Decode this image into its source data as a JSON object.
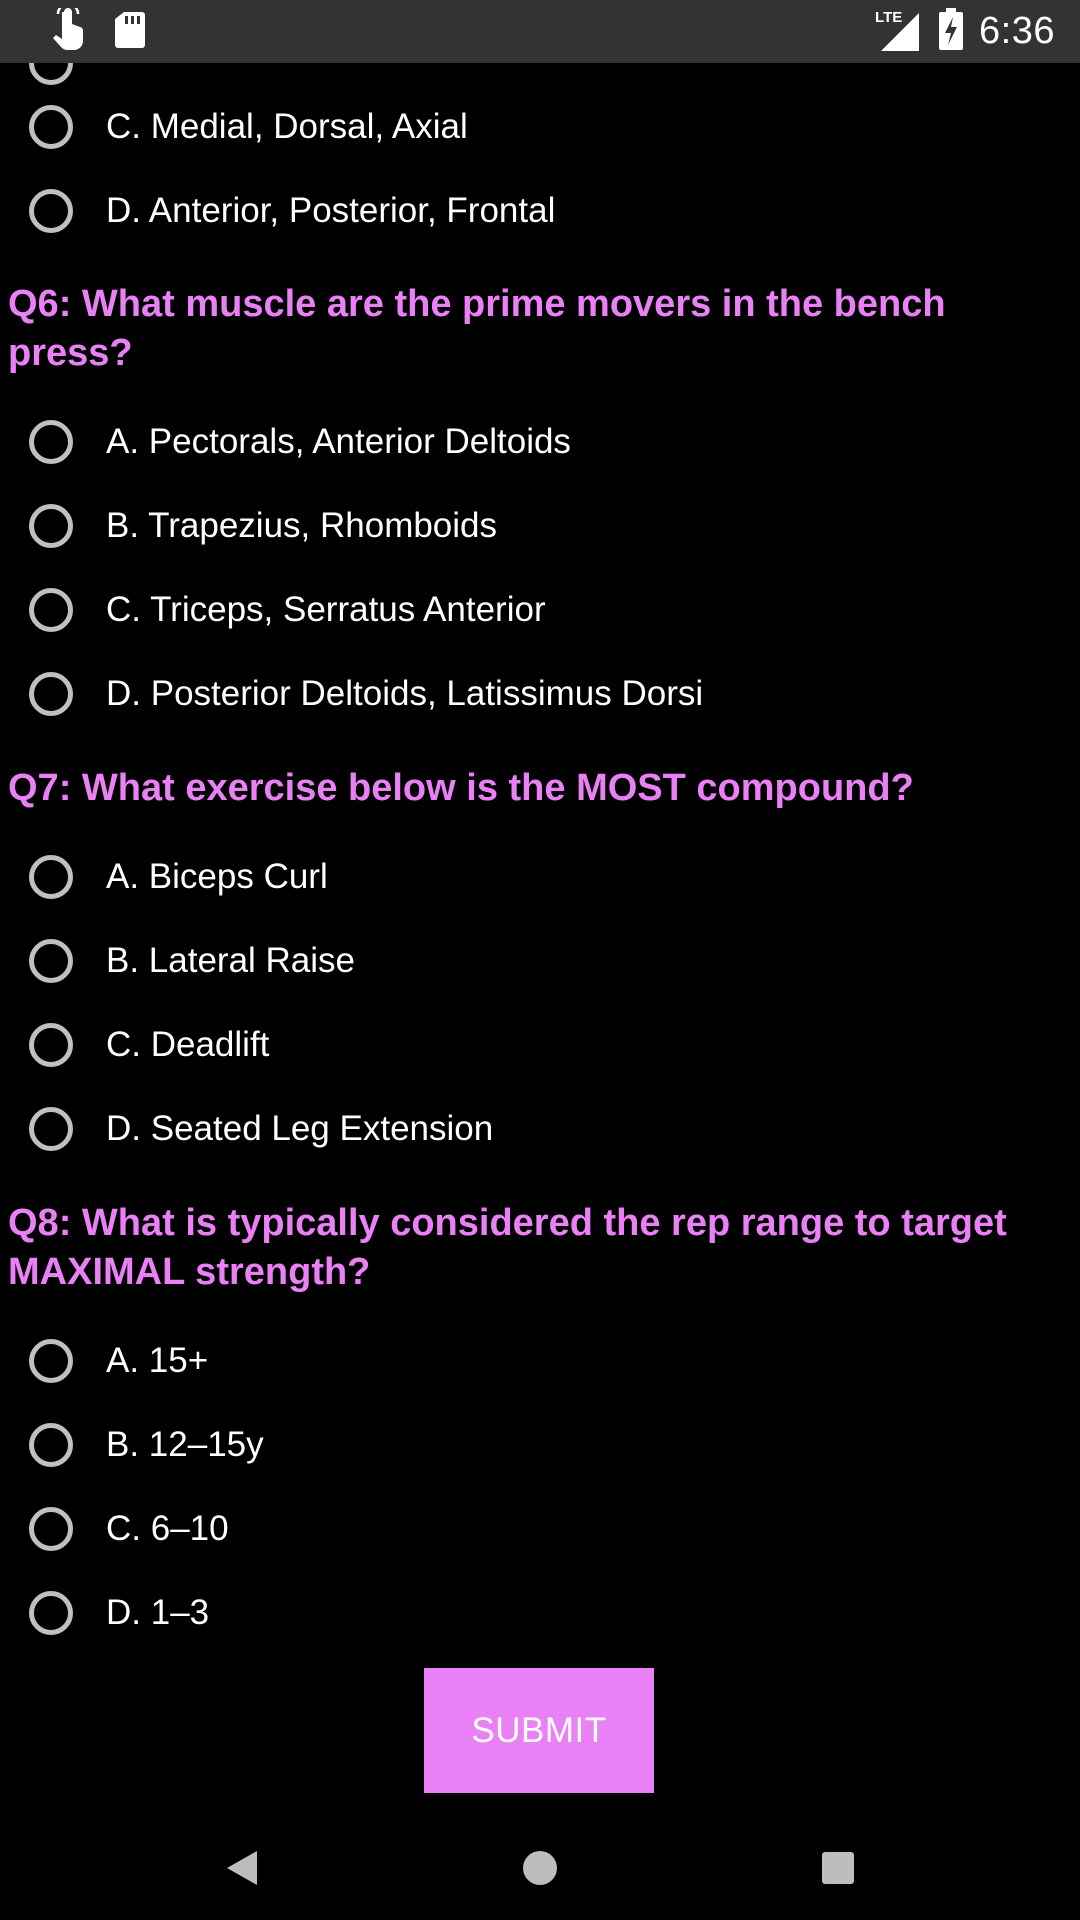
{
  "status_bar": {
    "time": "6:36",
    "network": "LTE",
    "icons": [
      "touch-gesture-icon",
      "sd-card-icon",
      "lte-signal-icon",
      "battery-charging-icon"
    ]
  },
  "partial_above": {
    "options": [
      {
        "label": "C. Medial, Dorsal, Axial"
      },
      {
        "label": "D. Anterior, Posterior, Frontal"
      }
    ]
  },
  "questions": [
    {
      "title": "Q6: What muscle are the prime movers in the bench press?",
      "options": [
        {
          "label": "A. Pectorals, Anterior Deltoids"
        },
        {
          "label": "B. Trapezius, Rhomboids"
        },
        {
          "label": "C. Triceps, Serratus Anterior"
        },
        {
          "label": "D. Posterior Deltoids, Latissimus Dorsi"
        }
      ]
    },
    {
      "title": "Q7: What exercise below is the MOST compound?",
      "options": [
        {
          "label": "A. Biceps Curl"
        },
        {
          "label": "B. Lateral Raise"
        },
        {
          "label": "C. Deadlift"
        },
        {
          "label": "D. Seated Leg Extension"
        }
      ]
    },
    {
      "title": "Q8: What is typically considered the rep range to target MAXIMAL strength?",
      "options": [
        {
          "label": "A. 15+"
        },
        {
          "label": "B. 12–15y"
        },
        {
          "label": "C. 6–10"
        },
        {
          "label": "D. 1–3"
        }
      ]
    }
  ],
  "submit": {
    "label": "SUBMIT"
  },
  "colors": {
    "accent": "#ea80f5",
    "background": "#000000",
    "status_bar": "#333333",
    "radio_border": "#c0c0c0",
    "text": "#ffffff"
  },
  "nav_bar": {
    "icons": [
      "back-icon",
      "home-icon",
      "recents-icon"
    ]
  }
}
